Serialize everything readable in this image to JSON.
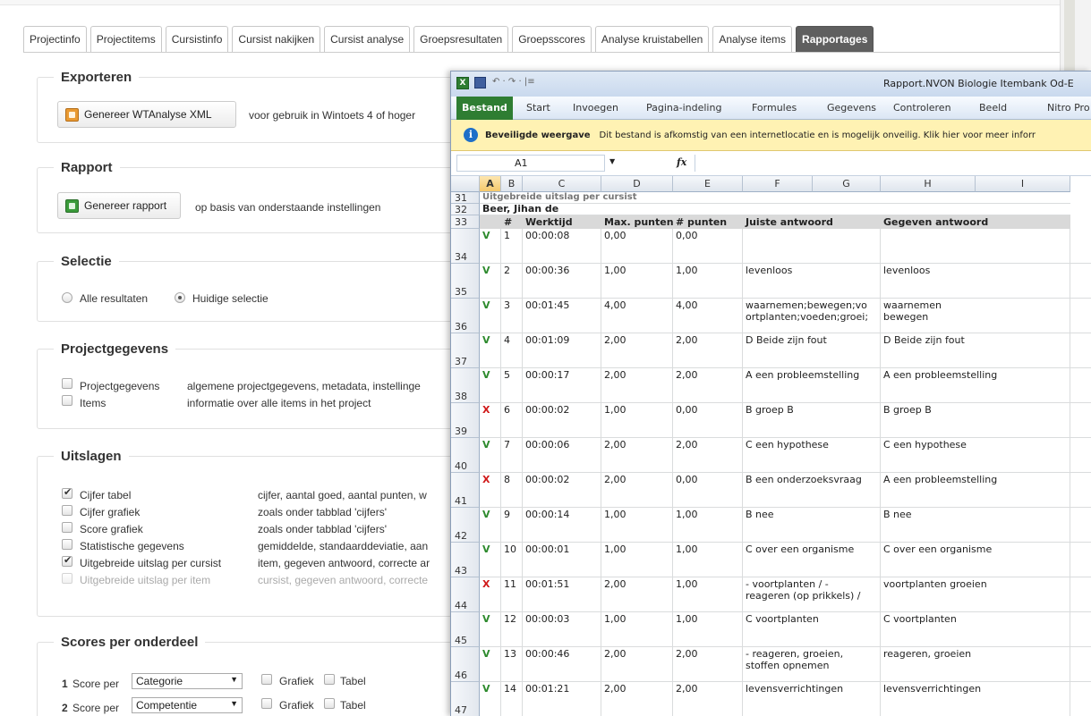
{
  "tabs": [
    "Projectinfo",
    "Projectitems",
    "Cursistinfo",
    "Cursist nakijken",
    "Cursist analyse",
    "Groepsresultaten",
    "Groepsscores",
    "Analyse kruistabellen",
    "Analyse items",
    "Rapportages"
  ],
  "sections": {
    "exporteren": {
      "title": "Exporteren",
      "button": "Genereer WTAnalyse XML",
      "note": "voor gebruik in Wintoets 4 of hoger"
    },
    "rapport": {
      "title": "Rapport",
      "button": "Genereer rapport",
      "note": "op basis van onderstaande instellingen"
    },
    "selectie": {
      "title": "Selectie",
      "opt1": "Alle resultaten",
      "opt2": "Huidige selectie"
    },
    "projectgegevens": {
      "title": "Projectgegevens",
      "items": [
        {
          "label": "Projectgegevens",
          "desc": "algemene projectgegevens, metadata, instellinge"
        },
        {
          "label": "Items",
          "desc": "informatie over alle items in het project"
        }
      ]
    },
    "uitslagen": {
      "title": "Uitslagen",
      "items": [
        {
          "label": "Cijfer tabel",
          "desc": "cijfer, aantal goed, aantal punten, w"
        },
        {
          "label": "Cijfer grafiek",
          "desc": "zoals onder tabblad 'cijfers'"
        },
        {
          "label": "Score grafiek",
          "desc": "zoals onder tabblad 'cijfers'"
        },
        {
          "label": "Statistische gegevens",
          "desc": "gemiddelde, standaarddeviatie, aan"
        },
        {
          "label": "Uitgebreide uitslag per cursist",
          "desc": "item, gegeven antwoord, correcte ar"
        },
        {
          "label": "Uitgebreide uitslag per item",
          "desc": "cursist, gegeven antwoord, correcte"
        }
      ]
    },
    "scores": {
      "title": "Scores per onderdeel",
      "rows": [
        {
          "num": "1",
          "label": "Score per",
          "value": "Categorie"
        },
        {
          "num": "2",
          "label": "Score per",
          "value": "Competentie"
        }
      ],
      "grafiek": "Grafiek",
      "tabel": "Tabel"
    }
  },
  "excel": {
    "title": "Rapport.NVON Biologie Itembank Od-E",
    "qat": "↶ · ↷ · |≡",
    "ribbon_tabs": [
      "Bestand",
      "Start",
      "Invoegen",
      "Pagina-indeling",
      "Formules",
      "Gegevens",
      "Controleren",
      "Beeld",
      "Nitro Pro"
    ],
    "msg_title": "Beveiligde weergave",
    "msg_text": "Dit bestand is afkomstig van een internetlocatie en is mogelijk onveilig. Klik hier voor meer inforr",
    "namebox": "A1",
    "fx": "fx",
    "columns": [
      "A",
      "B",
      "C",
      "D",
      "E",
      "F",
      "G",
      "H",
      "I"
    ],
    "row31": "Uitgebreide uitslag per cursist",
    "row32": "Beer, Jihan de",
    "headers": [
      "#",
      "Werktijd",
      "Max. punten",
      "# punten",
      "Juiste antwoord",
      "Gegeven antwoord"
    ],
    "rows": [
      {
        "r": "34",
        "m": "V",
        "n": "1",
        "t": "00:00:08",
        "max": "0,00",
        "p": "0,00",
        "j1": "",
        "j2": "",
        "g1": "",
        "g2": ""
      },
      {
        "r": "35",
        "m": "V",
        "n": "2",
        "t": "00:00:36",
        "max": "1,00",
        "p": "1,00",
        "j1": "levenloos",
        "j2": "",
        "g1": "levenloos",
        "g2": ""
      },
      {
        "r": "36",
        "m": "V",
        "n": "3",
        "t": "00:01:45",
        "max": "4,00",
        "p": "4,00",
        "j1": "waarnemen;bewegen;vo",
        "j2": "ortplanten;voeden;groei;",
        "g1": "waarnemen",
        "g2": "bewegen"
      },
      {
        "r": "37",
        "m": "V",
        "n": "4",
        "t": "00:01:09",
        "max": "2,00",
        "p": "2,00",
        "j1": "D Beide zijn fout",
        "j2": "",
        "g1": "D Beide zijn fout",
        "g2": ""
      },
      {
        "r": "38",
        "m": "V",
        "n": "5",
        "t": "00:00:17",
        "max": "2,00",
        "p": "2,00",
        "j1": "A een probleemstelling",
        "j2": "",
        "g1": "A een probleemstelling",
        "g2": ""
      },
      {
        "r": "39",
        "m": "X",
        "n": "6",
        "t": "00:00:02",
        "max": "1,00",
        "p": "0,00",
        "j1": "B groep B",
        "j2": "",
        "g1": "B groep B",
        "g2": ""
      },
      {
        "r": "40",
        "m": "V",
        "n": "7",
        "t": "00:00:06",
        "max": "2,00",
        "p": "2,00",
        "j1": "C een hypothese",
        "j2": "",
        "g1": "C een hypothese",
        "g2": ""
      },
      {
        "r": "41",
        "m": "X",
        "n": "8",
        "t": "00:00:02",
        "max": "2,00",
        "p": "0,00",
        "j1": "B een onderzoeksvraag",
        "j2": "",
        "g1": "A een probleemstelling",
        "g2": ""
      },
      {
        "r": "42",
        "m": "V",
        "n": "9",
        "t": "00:00:14",
        "max": "1,00",
        "p": "1,00",
        "j1": "B nee",
        "j2": "",
        "g1": "B nee",
        "g2": ""
      },
      {
        "r": "43",
        "m": "V",
        "n": "10",
        "t": "00:00:01",
        "max": "1,00",
        "p": "1,00",
        "j1": "C over een organisme",
        "j2": "",
        "g1": "C over een organisme",
        "g2": ""
      },
      {
        "r": "44",
        "m": "X",
        "n": "11",
        "t": "00:01:51",
        "max": "2,00",
        "p": "1,00",
        "j1": "- voortplanten / -",
        "j2": "reageren (op prikkels) /",
        "g1": "voortplanten groeien",
        "g2": ""
      },
      {
        "r": "45",
        "m": "V",
        "n": "12",
        "t": "00:00:03",
        "max": "1,00",
        "p": "1,00",
        "j1": "C voortplanten",
        "j2": "",
        "g1": "C voortplanten",
        "g2": ""
      },
      {
        "r": "46",
        "m": "V",
        "n": "13",
        "t": "00:00:46",
        "max": "2,00",
        "p": "2,00",
        "j1": "- reageren, groeien,",
        "j2": "stoffen opnemen",
        "g1": "reageren, groeien",
        "g2": ""
      },
      {
        "r": "47",
        "m": "V",
        "n": "14",
        "t": "00:01:21",
        "max": "2,00",
        "p": "2,00",
        "j1": "levensverrichtingen",
        "j2": "",
        "g1": "levensverrichtingen",
        "g2": ""
      }
    ]
  }
}
